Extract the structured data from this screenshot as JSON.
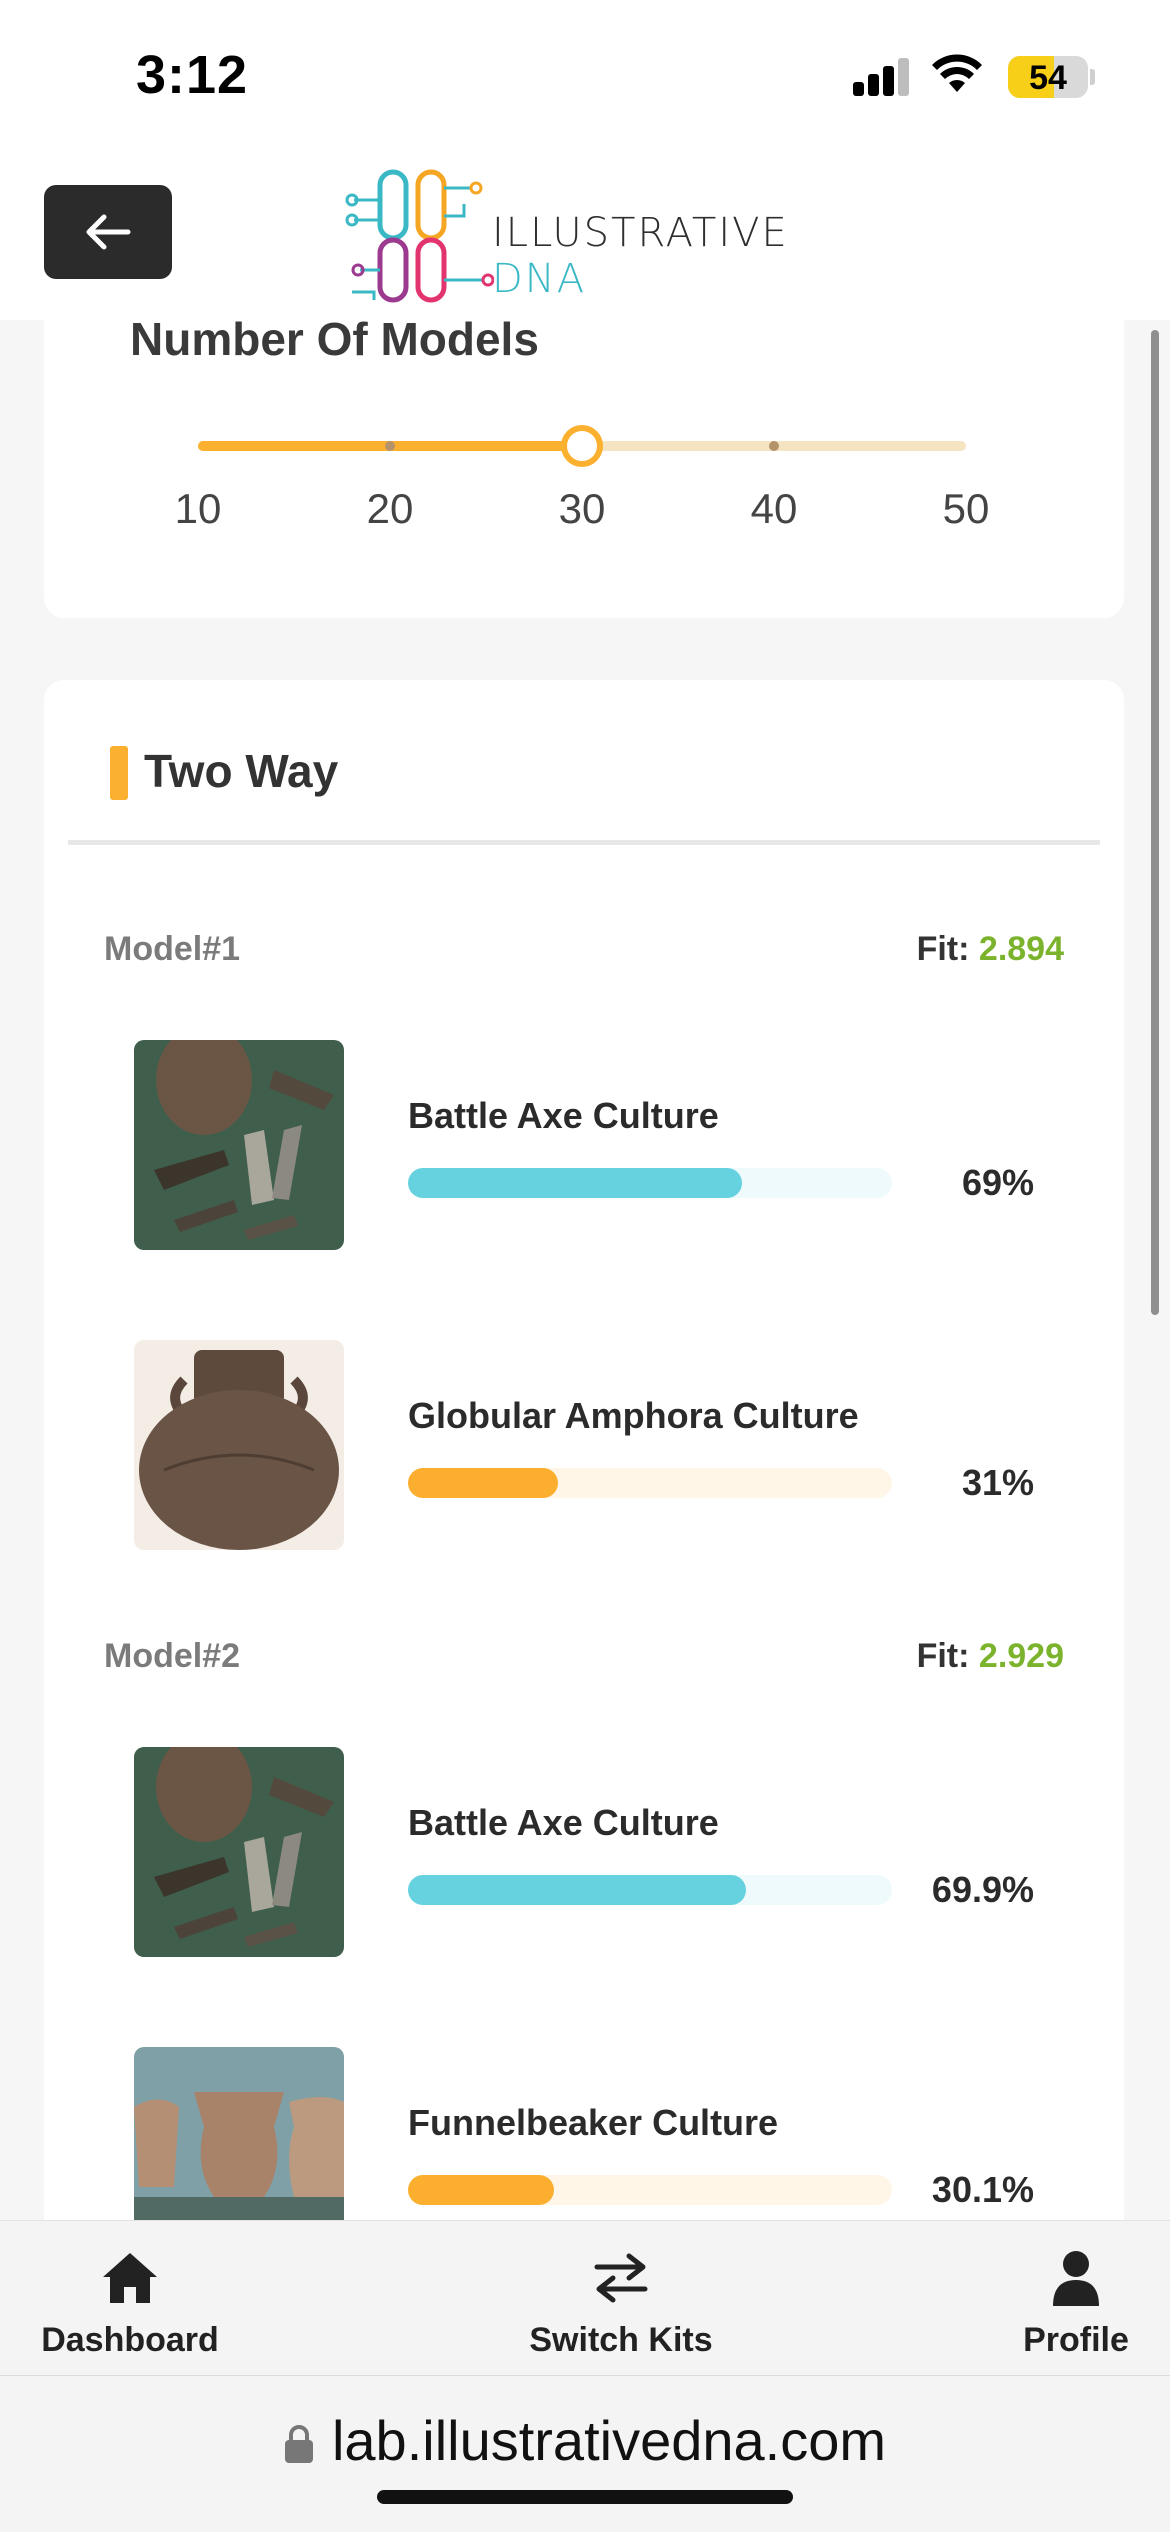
{
  "status": {
    "time": "3:12",
    "battery": "54"
  },
  "header": {
    "logo_text": "ILLUSTRATIVE",
    "logo_accent": "DNA"
  },
  "models": {
    "title": "Number Of Models",
    "ticks": [
      "10",
      "20",
      "30",
      "40",
      "50"
    ],
    "selected_value": 30
  },
  "twoway": {
    "title": "Two Way",
    "models": [
      {
        "label": "Model#1",
        "fit_label": "Fit:",
        "fit_value": "2.894",
        "populations": [
          {
            "name": "Battle Axe Culture",
            "percent": "69%",
            "fraction": 0.69,
            "color": "cyan"
          },
          {
            "name": "Globular Amphora Culture",
            "percent": "31%",
            "fraction": 0.31,
            "color": "orange"
          }
        ]
      },
      {
        "label": "Model#2",
        "fit_label": "Fit:",
        "fit_value": "2.929",
        "populations": [
          {
            "name": "Battle Axe Culture",
            "percent": "69.9%",
            "fraction": 0.699,
            "color": "cyan"
          },
          {
            "name": "Funnelbeaker Culture",
            "percent": "30.1%",
            "fraction": 0.301,
            "color": "orange"
          }
        ]
      }
    ]
  },
  "nav": {
    "dashboard": "Dashboard",
    "switch_kits": "Switch Kits",
    "profile": "Profile"
  },
  "browser": {
    "url": "lab.illustrativedna.com"
  },
  "colors": {
    "accent": "#fbb02f",
    "cyan": "#66d2df",
    "fit_green": "#7cb32d",
    "dark": "#2b2b2b"
  }
}
